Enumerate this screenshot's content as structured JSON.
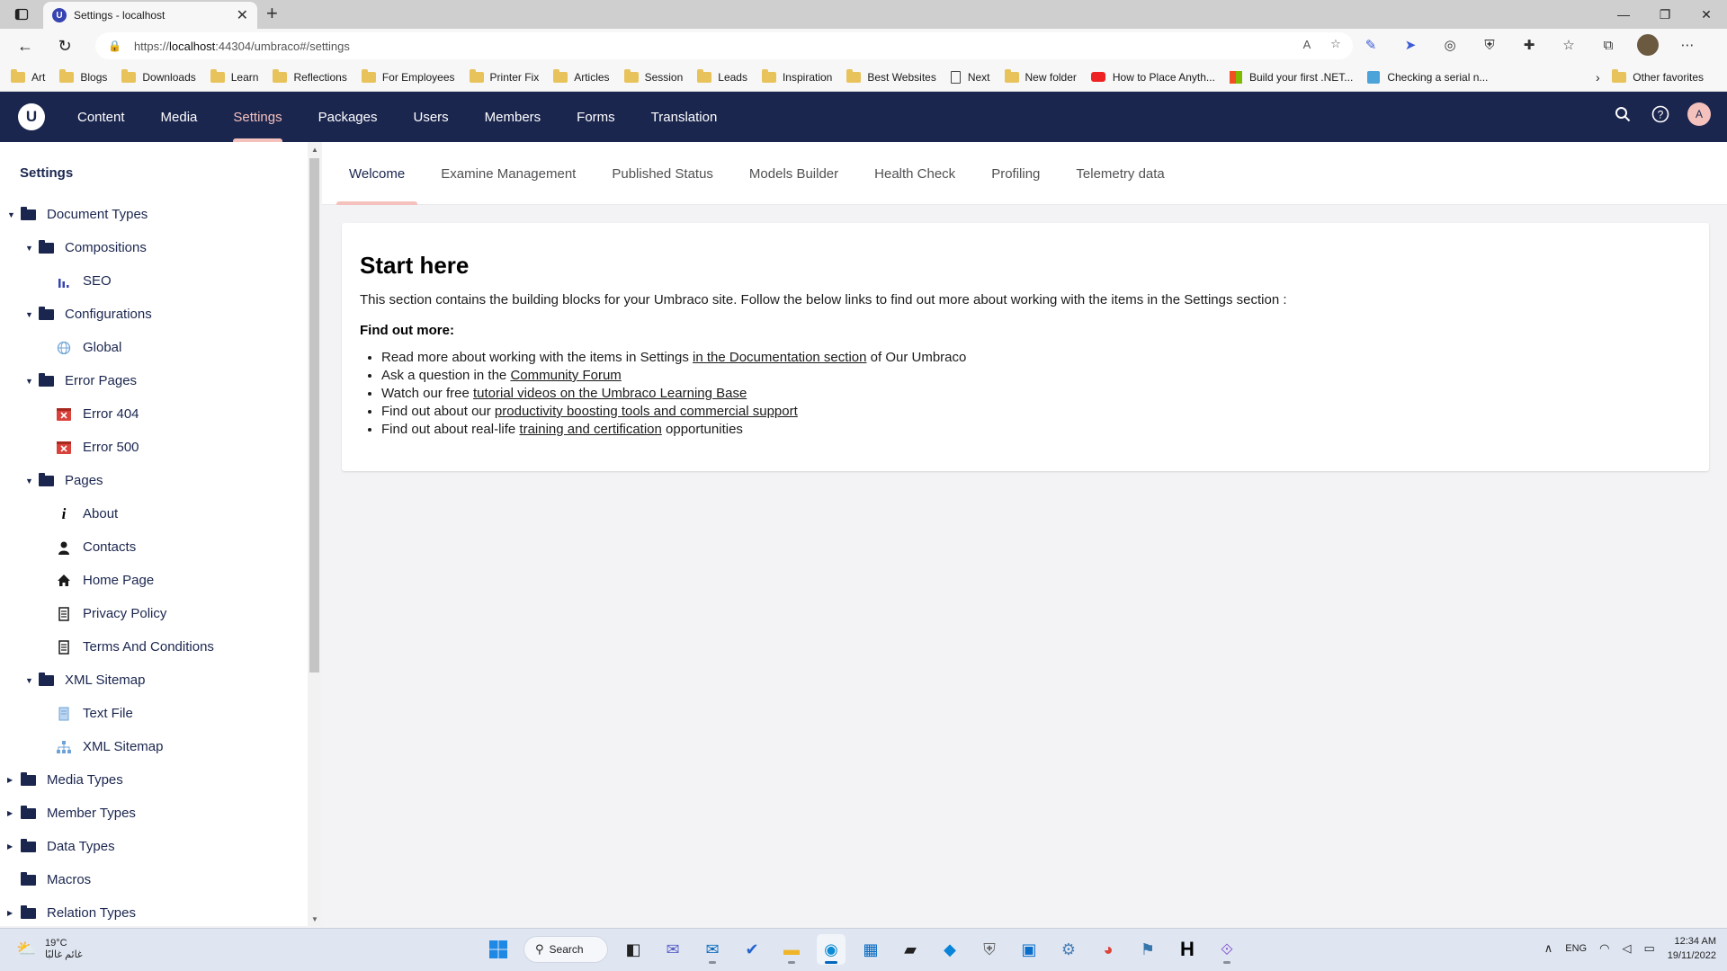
{
  "browser": {
    "tab_title": "Settings - localhost",
    "favicon_letter": "U",
    "url_prefix": "https://",
    "url_host": "localhost",
    "url_rest": ":44304/umbraco#/settings",
    "bookmarks": [
      {
        "label": "Art",
        "icon": "folder"
      },
      {
        "label": "Blogs",
        "icon": "folder"
      },
      {
        "label": "Downloads",
        "icon": "folder"
      },
      {
        "label": "Learn",
        "icon": "folder"
      },
      {
        "label": "Reflections",
        "icon": "folder"
      },
      {
        "label": "For Employees",
        "icon": "folder"
      },
      {
        "label": "Printer Fix",
        "icon": "folder"
      },
      {
        "label": "Articles",
        "icon": "folder"
      },
      {
        "label": "Session",
        "icon": "folder"
      },
      {
        "label": "Leads",
        "icon": "folder"
      },
      {
        "label": "Inspiration",
        "icon": "folder"
      },
      {
        "label": "Best Websites",
        "icon": "folder"
      },
      {
        "label": "Next",
        "icon": "page"
      },
      {
        "label": "New folder",
        "icon": "folder"
      },
      {
        "label": "How to Place Anyth...",
        "icon": "youtube"
      },
      {
        "label": "Build your first .NET...",
        "icon": "microsoft"
      },
      {
        "label": "Checking a serial n...",
        "icon": "up"
      }
    ],
    "other_favorites": "Other favorites"
  },
  "umbraco": {
    "logo_letter": "U",
    "sections": [
      {
        "label": "Content",
        "active": false
      },
      {
        "label": "Media",
        "active": false
      },
      {
        "label": "Settings",
        "active": true
      },
      {
        "label": "Packages",
        "active": false
      },
      {
        "label": "Users",
        "active": false
      },
      {
        "label": "Members",
        "active": false
      },
      {
        "label": "Forms",
        "active": false
      },
      {
        "label": "Translation",
        "active": false
      }
    ],
    "avatar_letter": "A",
    "accent_color": "#f5c1bc",
    "header_color": "#1b264f"
  },
  "tree": {
    "title": "Settings",
    "items": [
      {
        "label": "Document Types",
        "level": 0,
        "caret": "down",
        "icon": "folder-icon"
      },
      {
        "label": "Compositions",
        "level": 1,
        "caret": "down",
        "icon": "folder-icon"
      },
      {
        "label": "SEO",
        "level": 2,
        "caret": "",
        "icon": "bar-chart-icon"
      },
      {
        "label": "Configurations",
        "level": 1,
        "caret": "down",
        "icon": "folder-icon"
      },
      {
        "label": "Global",
        "level": 2,
        "caret": "",
        "icon": "globe-icon"
      },
      {
        "label": "Error Pages",
        "level": 1,
        "caret": "down",
        "icon": "folder-icon"
      },
      {
        "label": "Error 404",
        "level": 2,
        "caret": "",
        "icon": "error-icon"
      },
      {
        "label": "Error 500",
        "level": 2,
        "caret": "",
        "icon": "error-icon"
      },
      {
        "label": "Pages",
        "level": 1,
        "caret": "down",
        "icon": "folder-icon"
      },
      {
        "label": "About",
        "level": 2,
        "caret": "",
        "icon": "info-icon"
      },
      {
        "label": "Contacts",
        "level": 2,
        "caret": "",
        "icon": "contact-icon"
      },
      {
        "label": "Home Page",
        "level": 2,
        "caret": "",
        "icon": "home-icon"
      },
      {
        "label": "Privacy Policy",
        "level": 2,
        "caret": "",
        "icon": "document-icon"
      },
      {
        "label": "Terms And Conditions",
        "level": 2,
        "caret": "",
        "icon": "document-icon"
      },
      {
        "label": "XML Sitemap",
        "level": 1,
        "caret": "down",
        "icon": "folder-icon"
      },
      {
        "label": "Text File",
        "level": 2,
        "caret": "",
        "icon": "text-file-icon"
      },
      {
        "label": "XML Sitemap",
        "level": 2,
        "caret": "",
        "icon": "sitemap-icon"
      },
      {
        "label": "Media Types",
        "level": 0,
        "caret": "right",
        "icon": "folder-icon"
      },
      {
        "label": "Member Types",
        "level": 0,
        "caret": "right",
        "icon": "folder-icon"
      },
      {
        "label": "Data Types",
        "level": 0,
        "caret": "right",
        "icon": "folder-icon"
      },
      {
        "label": "Macros",
        "level": 0,
        "caret": "",
        "icon": "folder-icon"
      },
      {
        "label": "Relation Types",
        "level": 0,
        "caret": "right",
        "icon": "folder-icon"
      }
    ]
  },
  "dashboard": {
    "tabs": [
      {
        "label": "Welcome",
        "active": true
      },
      {
        "label": "Examine Management",
        "active": false
      },
      {
        "label": "Published Status",
        "active": false
      },
      {
        "label": "Models Builder",
        "active": false
      },
      {
        "label": "Health Check",
        "active": false
      },
      {
        "label": "Profiling",
        "active": false
      },
      {
        "label": "Telemetry data",
        "active": false
      }
    ],
    "heading": "Start here",
    "intro": "This section contains the building blocks for your Umbraco site. Follow the below links to find out more about working with the items in the Settings section :",
    "find_out_more": "Find out more:",
    "links": [
      {
        "before": "Read more about working with the items in Settings ",
        "link": "in the Documentation section",
        "after": " of Our Umbraco"
      },
      {
        "before": "Ask a question in the ",
        "link": "Community Forum",
        "after": ""
      },
      {
        "before": "Watch our free ",
        "link": "tutorial videos on the Umbraco Learning Base",
        "after": ""
      },
      {
        "before": "Find out about our ",
        "link": "productivity boosting tools and commercial support",
        "after": ""
      },
      {
        "before": "Find out about real-life ",
        "link": "training and certification",
        "after": " opportunities"
      }
    ]
  },
  "taskbar": {
    "temperature": "19°C",
    "weather_text": "غائم غالبًا",
    "search_label": "Search",
    "language": "ENG",
    "time": "12:34 AM",
    "date": "19/11/2022"
  }
}
